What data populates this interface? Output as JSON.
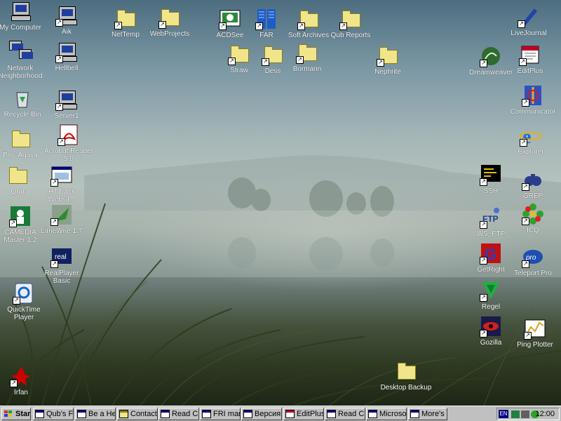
{
  "desktop": {
    "icons": [
      {
        "id": "my-computer",
        "label": "My Computer",
        "kind": "computer",
        "shortcut": false
      },
      {
        "id": "aik",
        "label": "Aik",
        "kind": "computer",
        "shortcut": true
      },
      {
        "id": "network-neighborhood",
        "label": "Network Neighborhood",
        "kind": "network",
        "shortcut": false
      },
      {
        "id": "hellbell",
        "label": "Hellbell",
        "kind": "computer",
        "shortcut": true
      },
      {
        "id": "recycle-bin",
        "label": "Recycle Bin",
        "kind": "recycle",
        "shortcut": false
      },
      {
        "id": "server1",
        "label": "Server1",
        "kind": "computer",
        "shortcut": true
      },
      {
        "id": "proj-agava",
        "label": "Proj-Agava",
        "kind": "folder",
        "shortcut": false
      },
      {
        "id": "acrobat-reader",
        "label": "Acrobat Reader 5.0",
        "kind": "acrobat",
        "shortcut": true
      },
      {
        "id": "qub",
        "label": "Qub",
        "kind": "folder",
        "shortcut": false
      },
      {
        "id": "httrack",
        "label": "HTTrack Websit...",
        "kind": "httrack",
        "shortcut": true
      },
      {
        "id": "camedia",
        "label": "CAMEDIA Master 1.2",
        "kind": "camedia",
        "shortcut": true
      },
      {
        "id": "limewire",
        "label": "LimeWire 1.7",
        "kind": "limewire",
        "shortcut": true
      },
      {
        "id": "realplayer",
        "label": "RealPlayer Basic",
        "kind": "real",
        "shortcut": true
      },
      {
        "id": "quicktime",
        "label": "QuickTime Player",
        "kind": "quicktime",
        "shortcut": true
      },
      {
        "id": "irfan",
        "label": "Irfan",
        "kind": "irfan",
        "shortcut": true
      },
      {
        "id": "nettemp",
        "label": "NetTemp",
        "kind": "folder",
        "shortcut": true
      },
      {
        "id": "webprojects",
        "label": "WebProjects",
        "kind": "folder",
        "shortcut": true
      },
      {
        "id": "acdsee",
        "label": "ACDSee",
        "kind": "acdsee",
        "shortcut": true
      },
      {
        "id": "far",
        "label": "FAR",
        "kind": "far",
        "shortcut": true
      },
      {
        "id": "soft-archives",
        "label": "Soft Archives",
        "kind": "folder",
        "shortcut": true
      },
      {
        "id": "qub-reports",
        "label": "Qub Reports",
        "kind": "folder",
        "shortcut": true
      },
      {
        "id": "straw",
        "label": "Straw",
        "kind": "folder",
        "shortcut": true
      },
      {
        "id": "dess",
        "label": "Dess",
        "kind": "folder",
        "shortcut": true
      },
      {
        "id": "bormann",
        "label": "Bormann",
        "kind": "folder",
        "shortcut": true
      },
      {
        "id": "nephrite",
        "label": "Nephrite",
        "kind": "folder",
        "shortcut": true
      },
      {
        "id": "desktop-backup",
        "label": "Desktop Backup",
        "kind": "folder",
        "shortcut": false
      },
      {
        "id": "livejournal",
        "label": "LiveJournal",
        "kind": "pen",
        "shortcut": true
      },
      {
        "id": "dreamweaver",
        "label": "Dreamweaver",
        "kind": "dreamweaver",
        "shortcut": true
      },
      {
        "id": "editplus",
        "label": "EditPlus",
        "kind": "editplus",
        "shortcut": true
      },
      {
        "id": "communicator",
        "label": "Communicator",
        "kind": "communicator",
        "shortcut": true
      },
      {
        "id": "explorer",
        "label": "Explorer",
        "kind": "ie",
        "shortcut": true
      },
      {
        "id": "ssh",
        "label": "SSH",
        "kind": "ssh",
        "shortcut": true
      },
      {
        "id": "grep",
        "label": "GREP",
        "kind": "grep",
        "shortcut": true
      },
      {
        "id": "ws-ftp",
        "label": "WS_FTP",
        "kind": "ftp",
        "shortcut": true
      },
      {
        "id": "icq",
        "label": "ICQ",
        "kind": "icq",
        "shortcut": true
      },
      {
        "id": "getright",
        "label": "GetRight",
        "kind": "getright",
        "shortcut": true
      },
      {
        "id": "teleport-pro",
        "label": "Teleport Pro",
        "kind": "teleport",
        "shortcut": true
      },
      {
        "id": "regel",
        "label": "Regel",
        "kind": "regel",
        "shortcut": true
      },
      {
        "id": "gozilla",
        "label": "Gozilla",
        "kind": "gozilla",
        "shortcut": true
      },
      {
        "id": "ping-plotter",
        "label": "Ping Plotter",
        "kind": "ping",
        "shortcut": true
      }
    ]
  },
  "taskbar": {
    "start_label": "Start",
    "buttons": [
      {
        "label": "Qub's Fr...",
        "icon": "window-icon"
      },
      {
        "label": "Be a He...",
        "icon": "window-icon"
      },
      {
        "label": "Contacts",
        "icon": "folder-icon"
      },
      {
        "label": "Read C...",
        "icon": "window-icon"
      },
      {
        "label": "FRI man...",
        "icon": "window-icon"
      },
      {
        "label": "Версия ...",
        "icon": "window-icon"
      },
      {
        "label": "EditPlus...",
        "icon": "editplus-icon"
      },
      {
        "label": "Read C...",
        "icon": "window-icon"
      },
      {
        "label": "Microsof...",
        "icon": "window-icon"
      },
      {
        "label": "More's F...",
        "icon": "window-icon"
      }
    ],
    "tray": {
      "language": "EN",
      "clock": "12:00"
    }
  },
  "colors": {
    "taskbar": "#c0c0c0",
    "label_text": "#ffffff",
    "folder": "#f0e58a"
  }
}
